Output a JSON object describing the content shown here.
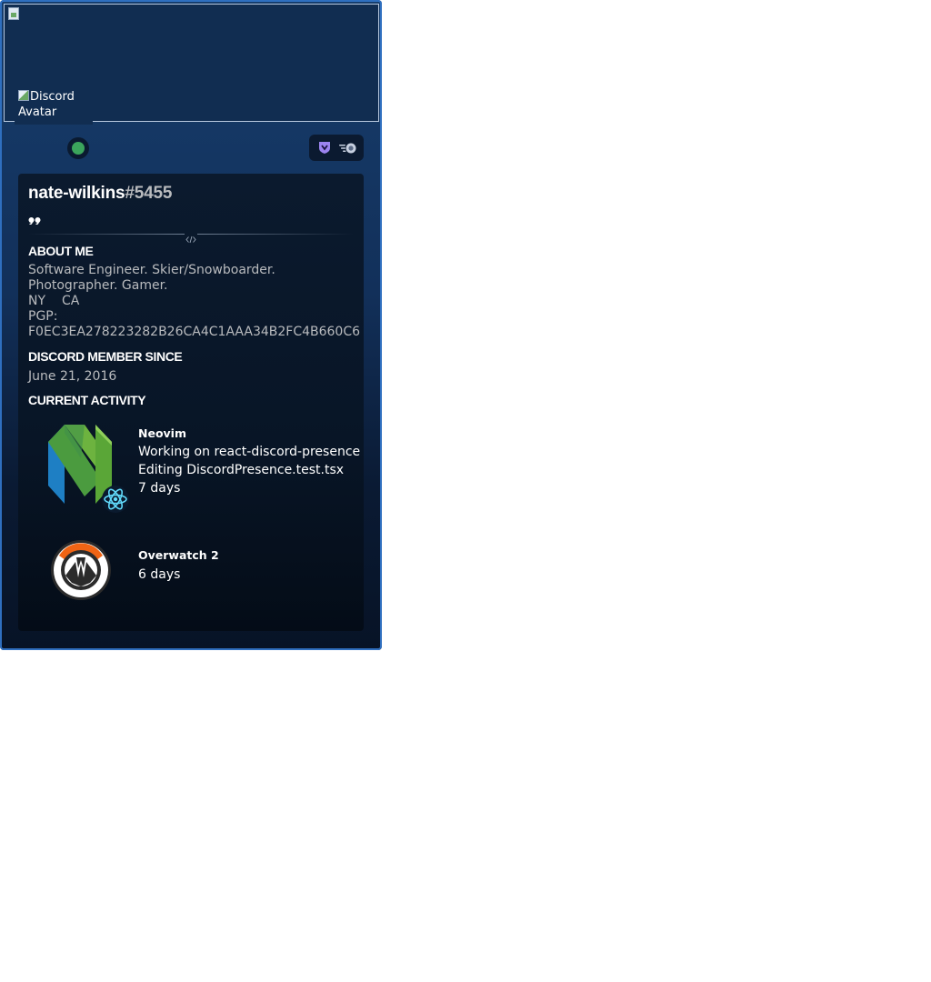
{
  "banner": {
    "image_alt": ""
  },
  "avatar": {
    "alt": "Discord Avatar"
  },
  "status": {
    "state": "online",
    "color": "#3ba55c"
  },
  "badges": [
    {
      "name": "hypesquad-icon",
      "color": "#9c84ef"
    },
    {
      "name": "nitro-icon",
      "color": "#c7d0e0"
    }
  ],
  "user": {
    "username": "nate-wilkins",
    "discriminator": "#5455"
  },
  "sections": {
    "about_title": "ABOUT ME",
    "member_since_title": "DISCORD MEMBER SINCE",
    "activity_title": "CURRENT ACTIVITY"
  },
  "about": {
    "line1": "Software Engineer. Skier/Snowboarder. Photographer. Gamer.",
    "line2a": "NY",
    "line2b": "CA",
    "line3": "PGP:",
    "line4": "F0EC3EA278223282B26CA4C1AAA34B2FC4B660C6"
  },
  "member_since": "June 21, 2016",
  "activities": [
    {
      "name": "Neovim",
      "details": "Working on react-discord-presence",
      "state": "Editing DiscordPresence.test.tsx",
      "elapsed": "7 days",
      "large_icon": "neovim-logo-icon",
      "small_icon": "react-logo-icon"
    },
    {
      "name": "Overwatch 2",
      "elapsed": "6 days",
      "large_icon": "overwatch-logo-icon"
    }
  ],
  "colors": {
    "card_border": "#2f6fbf",
    "card_top": "#173d6c",
    "inner_bg": "#0b1a2e",
    "text_primary": "#ffffff",
    "text_muted": "#b9bbbe",
    "neovim_green": "#6db33f",
    "neovim_blue": "#1e7fc4",
    "react_cyan": "#61dafb",
    "overwatch_orange": "#f99e1a"
  }
}
